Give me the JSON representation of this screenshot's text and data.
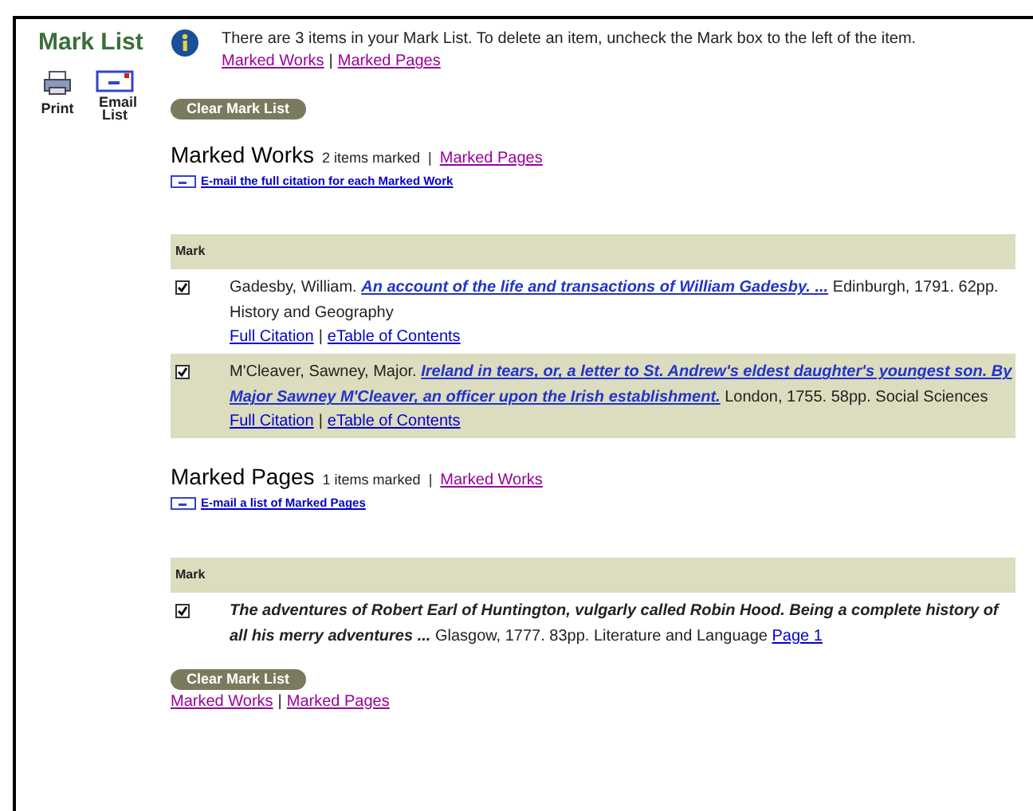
{
  "sidebar": {
    "title": "Mark List",
    "tools": [
      {
        "kind": "print",
        "label": "Print"
      },
      {
        "kind": "email",
        "label": "Email List"
      }
    ]
  },
  "notice": {
    "text": "There are 3 items in your Mark List. To delete an item, uncheck the Mark box to the left of the item.",
    "links": [
      "Marked Works",
      "Marked Pages"
    ],
    "separator": "|"
  },
  "clear_button_top": "Clear Mark List",
  "sections": [
    {
      "title": "Marked Works",
      "count": "2 items marked",
      "separator": "|",
      "other_link": "Marked Pages",
      "email_link": "E-mail the full citation for each Marked Work",
      "column": "Mark",
      "rows": [
        {
          "kind": "work",
          "checked": true,
          "shaded": false,
          "author": "Gadesby, William.",
          "title": "An account of the life and transactions of William Gadesby. ...",
          "rest": "Edinburgh, 1791. 62pp. History and Geography",
          "links": [
            "Full Citation",
            "eTable of Contents"
          ],
          "separator": "|"
        },
        {
          "kind": "work",
          "checked": true,
          "shaded": true,
          "author": "M'Cleaver, Sawney, Major.",
          "title": "Ireland in tears, or, a letter to St. Andrew's eldest daughter's youngest son. By Major Sawney M'Cleaver, an officer upon the Irish establishment.",
          "rest": "London, 1755. 58pp. Social Sciences",
          "links": [
            "Full Citation",
            "eTable of Contents"
          ],
          "separator": "|"
        }
      ]
    },
    {
      "title": "Marked Pages",
      "count": "1 items marked",
      "separator": "|",
      "other_link": "Marked Works",
      "email_link": "E-mail a list of Marked Pages",
      "column": "Mark",
      "rows": [
        {
          "kind": "page",
          "checked": true,
          "shaded": false,
          "title": "The adventures of Robert Earl of Huntington, vulgarly called Robin Hood. Being a complete history of all his merry adventures ...",
          "rest": "Glasgow, 1777. 83pp. Literature and Language",
          "page_link": "Page 1"
        }
      ]
    }
  ],
  "clear_button_bottom": "Clear Mark List",
  "footer_links": [
    "Marked Works",
    "Marked Pages"
  ],
  "footer_separator": "|"
}
